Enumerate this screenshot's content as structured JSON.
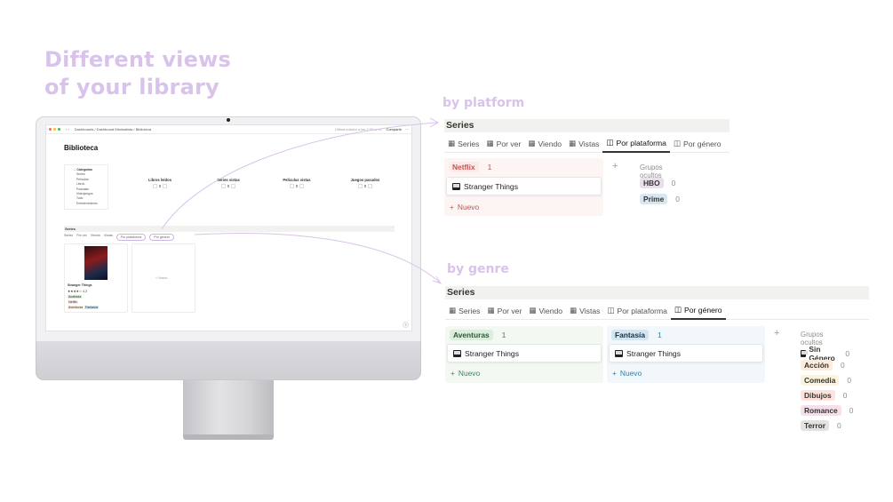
{
  "headline": {
    "line1": "Different views",
    "line2": "of your library"
  },
  "labels": {
    "by_platform": "by platform",
    "by_genre": "by genre"
  },
  "screen": {
    "breadcrumb": "Dashboards / Dashboard Minimalista / Biblioteca",
    "edited": "Última edición a las 2:00 a. m.",
    "share": "Compartir",
    "title": "Biblioteca",
    "categories_header": "Categorías",
    "categories": [
      "Series",
      "Películas",
      "Libros",
      "Podcasts",
      "Videojuegos",
      "Todo Entretenimiento"
    ],
    "stats": [
      "Libros leídos",
      "Series vistas",
      "Películas vistas",
      "Juegos pasados"
    ],
    "stat_value": "0",
    "series_title": "Series",
    "tabs": [
      "Series",
      "Por ver",
      "Viendo",
      "Vistas",
      "Por plataforma",
      "Por género"
    ],
    "card": {
      "title": "Stranger Things",
      "rating": "★★★★☆ 4.2",
      "status": "Acabada",
      "platform": "Netflix",
      "genres": [
        "Aventuras",
        "Fantasía"
      ]
    },
    "new": "+ Nuevo",
    "help": "?"
  },
  "platform_board": {
    "title": "Series",
    "tabs": [
      "Series",
      "Por ver",
      "Viendo",
      "Vistas",
      "Por plataforma",
      "Por género"
    ],
    "active_tab": "Por plataforma",
    "group": {
      "name": "Netflix",
      "count": "1",
      "card": "Stranger Things",
      "new": "Nuevo"
    },
    "hidden_header": "Grupos ocultos",
    "hidden": [
      {
        "name": "HBO",
        "count": "0"
      },
      {
        "name": "Prime",
        "count": "0"
      }
    ]
  },
  "genre_board": {
    "title": "Series",
    "tabs": [
      "Series",
      "Por ver",
      "Viendo",
      "Vistas",
      "Por plataforma",
      "Por género"
    ],
    "active_tab": "Por género",
    "groups": [
      {
        "name": "Aventuras",
        "count": "1",
        "card": "Stranger Things",
        "new": "Nuevo"
      },
      {
        "name": "Fantasía",
        "count": "1",
        "card": "Stranger Things",
        "new": "Nuevo"
      }
    ],
    "hidden_header": "Grupos ocultos",
    "hidden": [
      {
        "name": "Sin Género",
        "count": "0"
      },
      {
        "name": "Acción",
        "count": "0"
      },
      {
        "name": "Comedia",
        "count": "0"
      },
      {
        "name": "Dibujos",
        "count": "0"
      },
      {
        "name": "Romance",
        "count": "0"
      },
      {
        "name": "Terror",
        "count": "0"
      }
    ]
  },
  "colors": {
    "accent": "#d9c3ea",
    "netflix_bg": "#fdebec",
    "netflix_text": "#c4554d",
    "hbo_bg": "#e8deee",
    "prime_bg": "#d8e6f1",
    "aventuras_bg": "#dbeddb",
    "fantasia_bg": "#d3e5ef",
    "accion_bg": "#fbecdd",
    "comedia_bg": "#fbf3db",
    "dibujos_bg": "#ffe2dd",
    "romance_bg": "#f4dfeb",
    "terror_bg": "#e3e2e0"
  }
}
